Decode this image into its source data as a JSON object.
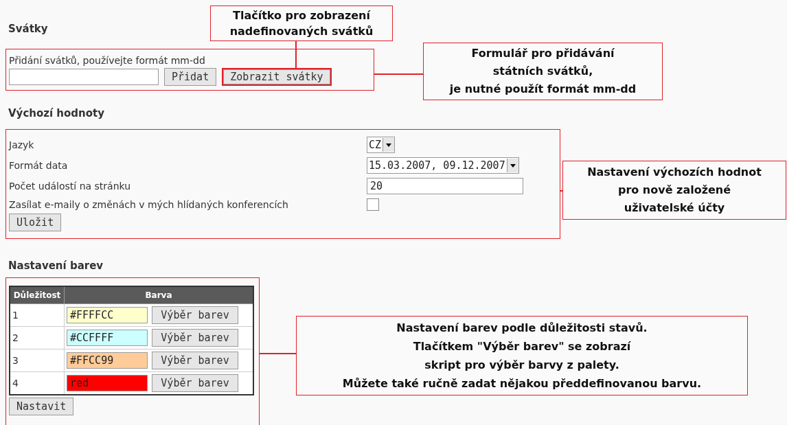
{
  "holidays": {
    "title": "Svátky",
    "hint": "Přidání svátků, používejte formát mm-dd",
    "buttons": [
      {
        "label": "Přidat",
        "highlighted": false
      },
      {
        "label": "Zobrazit svátky",
        "highlighted": true
      }
    ]
  },
  "defaults": {
    "title": "Výchozí hodnoty",
    "rows": [
      {
        "kind": "select",
        "label": "Jazyk",
        "value": "CZ"
      },
      {
        "kind": "select",
        "label": "Formát data",
        "value": "15.03.2007, 09.12.2007"
      },
      {
        "kind": "text",
        "label": "Počet událostí na stránku",
        "value": "20"
      },
      {
        "kind": "checkbox",
        "label": "Zasílat e-maily o změnách v mých hlídaných konferencích",
        "checked": false
      }
    ],
    "save_button": "Uložit"
  },
  "colors": {
    "title": "Nastavení barev",
    "columns": [
      "Důležitost",
      "Barva"
    ],
    "rows": [
      {
        "importance": "1",
        "value": "#FFFFCC",
        "color": "#ffffcc",
        "button": "Výběr barev"
      },
      {
        "importance": "2",
        "value": "#CCFFFF",
        "color": "#ccffff",
        "button": "Výběr barev"
      },
      {
        "importance": "3",
        "value": "#FFCC99",
        "color": "#ffcc99",
        "button": "Výběr barev"
      },
      {
        "importance": "4",
        "value": "red",
        "color": "#ff0000",
        "button": "Výběr barev"
      }
    ],
    "submit_button": "Nastavit"
  },
  "annotations": [
    {
      "text": "Tlačítko pro zobrazení\nnadefinovaných svátků"
    },
    {
      "text": "Formulář pro přidávání\nstátních svátků,\nje nutné použít formát mm-dd"
    },
    {
      "text": "Nastavení výchozích hodnot\npro nově založené\nuživatelské účty"
    },
    {
      "text": "Nastavení barev podle důležitosti stavů.\nTlačítkem \"Výběr barev\" se zobrazí\nskript pro výběr barvy z palety.\nMůžete také ručně zadat nějakou předdefinovanou barvu."
    }
  ]
}
